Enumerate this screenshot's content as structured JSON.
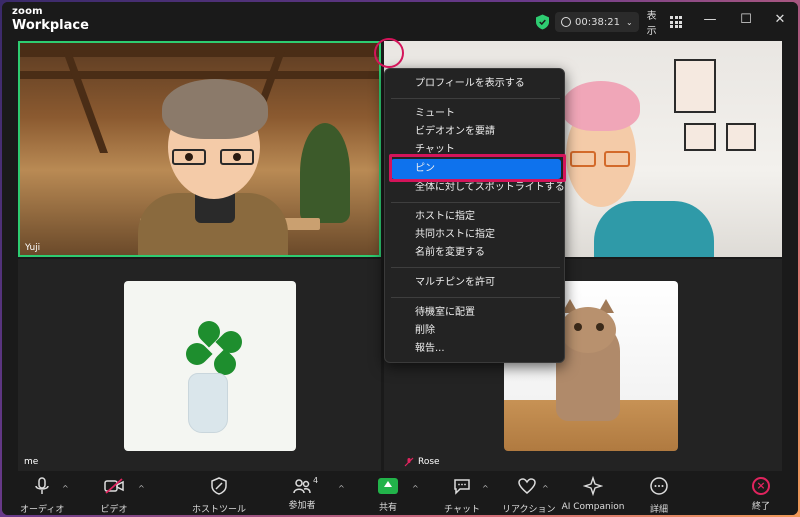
{
  "app": {
    "brand_top": "zoom",
    "brand_bottom": "Workplace"
  },
  "titlebar": {
    "timer": "00:38:21",
    "view_label": "表示",
    "minimize": "—",
    "maximize": "☐",
    "close": "✕"
  },
  "tiles": {
    "yuji_name": "Yuji",
    "me_name": "me",
    "rose_name": "Rose"
  },
  "context_menu": {
    "items": [
      "プロフィールを表示する",
      "ミュート",
      "ビデオオンを要請",
      "チャット",
      "ピン",
      "全体に対してスポットライトする",
      "ホストに指定",
      "共同ホストに指定",
      "名前を変更する",
      "マルチピンを許可",
      "待機室に配置",
      "削除",
      "報告..."
    ],
    "highlighted_index": 4
  },
  "toolbar": {
    "audio": "オーディオ",
    "video": "ビデオ",
    "host_tools": "ホストツール",
    "participants": "参加者",
    "participant_count": "4",
    "share": "共有",
    "chat": "チャット",
    "reactions": "リアクション",
    "ai_companion": "AI Companion",
    "more": "詳細",
    "end": "終了"
  },
  "colors": {
    "active_speaker_border": "#2ecc71",
    "menu_highlight": "#0e72ed",
    "annotation": "#d4145a",
    "share_green": "#22b34a",
    "end_red": "#e0245e"
  }
}
